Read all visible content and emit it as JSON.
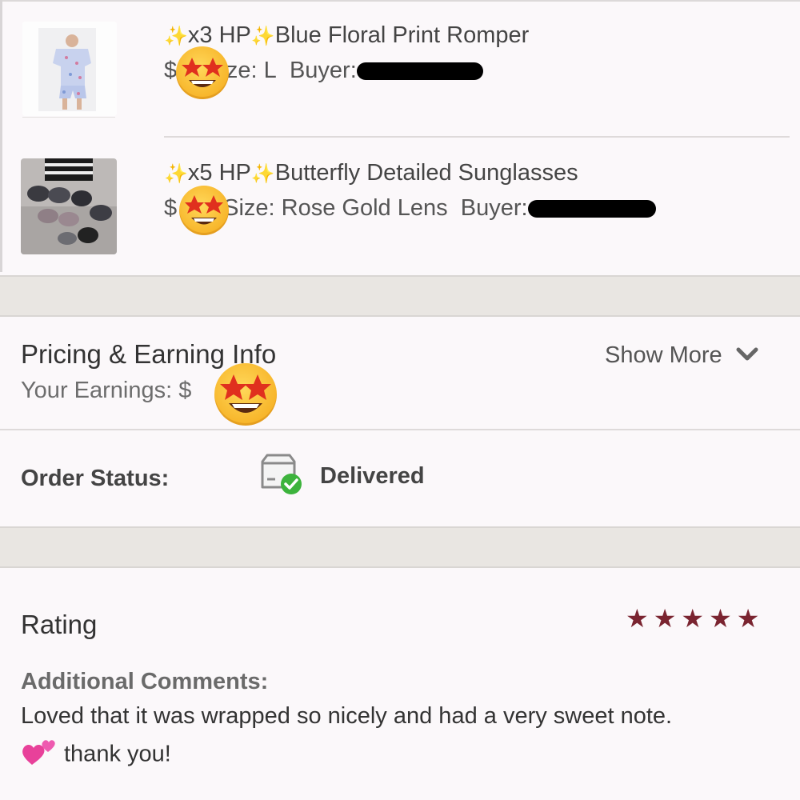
{
  "items": [
    {
      "prefix": "x3 HP",
      "title": "Blue Floral Print Romper",
      "currency": "$",
      "size": "Size: L",
      "buyer_label": "Buyer:",
      "image": "romper-thumbnail"
    },
    {
      "prefix": "x5 HP",
      "title": "Butterfly Detailed Sunglasses",
      "currency": "$",
      "size": "Size: Rose Gold Lens",
      "buyer_label": "Buyer:",
      "image": "sunglasses-thumbnail"
    }
  ],
  "pricing": {
    "title": "Pricing & Earning Info",
    "earnings_label": "Your Earnings: $",
    "show_more": "Show More"
  },
  "order": {
    "label": "Order Status:",
    "status": "Delivered",
    "status_color": "#3cb33c"
  },
  "rating": {
    "title": "Rating",
    "stars": 5,
    "star_color": "#7a2430",
    "comments_label": "Additional Comments:",
    "comment_line1": "Loved that it was wrapped so nicely and had a very sweet note.",
    "comment_line2": "thank you!"
  },
  "icons": {
    "sparkles": "sparkles-icon",
    "star_struck": "star-struck-emoji",
    "package_check": "package-check-icon",
    "chevron": "chevron-down-icon",
    "hearts": "two-hearts-emoji"
  }
}
